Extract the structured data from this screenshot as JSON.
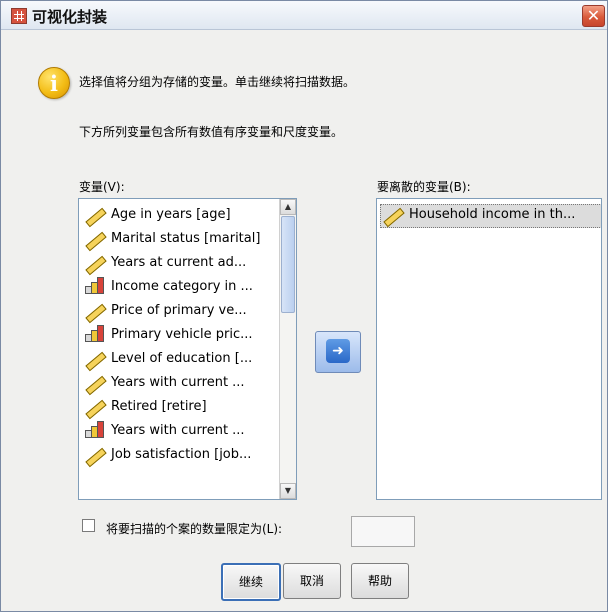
{
  "window": {
    "title": "可视化封装",
    "close_glyph": "✕"
  },
  "header": {
    "info_icon": "info-icon",
    "info_glyph": "i",
    "message": "选择值将分组为存储的变量。单击继续将扫描数据。",
    "sub_message": "下方所列变量包含所有数值有序变量和尺度变量。"
  },
  "variables": {
    "label": "变量(V):",
    "items": [
      {
        "name": "Age in years [age]",
        "icon": "ruler-icon"
      },
      {
        "name": "Marital status [marital]",
        "icon": "ruler-icon"
      },
      {
        "name": "Years at current ad...",
        "icon": "ruler-icon"
      },
      {
        "name": "Income category in ...",
        "icon": "bar-chart-icon"
      },
      {
        "name": "Price of primary ve...",
        "icon": "ruler-icon"
      },
      {
        "name": "Primary vehicle pric...",
        "icon": "bar-chart-icon"
      },
      {
        "name": "Level of education [...",
        "icon": "ruler-icon"
      },
      {
        "name": "Years with current ...",
        "icon": "ruler-icon"
      },
      {
        "name": "Retired [retire]",
        "icon": "ruler-icon"
      },
      {
        "name": "Years with current ...",
        "icon": "bar-chart-icon"
      },
      {
        "name": "Job satisfaction [job...",
        "icon": "ruler-icon"
      }
    ]
  },
  "move_button": {
    "icon": "arrow-right-icon",
    "glyph": "➜"
  },
  "discretize": {
    "label": "要离散的变量(B):",
    "items": [
      {
        "name": "Household income in th...",
        "icon": "ruler-icon"
      }
    ]
  },
  "limit": {
    "label": "将要扫描的个案的数量限定为(L):",
    "checked": false,
    "value": ""
  },
  "buttons": {
    "continue": "继续",
    "cancel": "取消",
    "help": "帮助"
  },
  "colors": {
    "accent": "#3b6fb6",
    "title_bg": "#dfe7f1",
    "ruler": "#f6d35b",
    "bars": [
      "#d9d9d9",
      "#f0c838",
      "#d8433a"
    ]
  }
}
